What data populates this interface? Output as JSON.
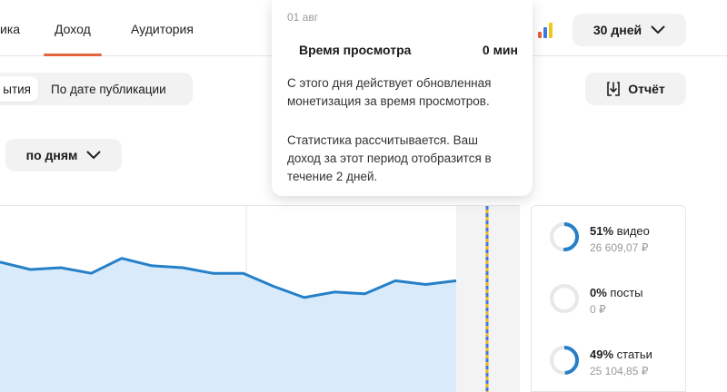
{
  "tabs": [
    {
      "label": "ика"
    },
    {
      "label": "Доход"
    },
    {
      "label": "Аудитория"
    }
  ],
  "period": {
    "label": "30 дней"
  },
  "segment": {
    "items": [
      {
        "label": "ытия"
      },
      {
        "label": "По дате публикации"
      }
    ]
  },
  "report": {
    "label": "Отчёт"
  },
  "granularity": {
    "label": "по дням"
  },
  "tooltip": {
    "date": "01 авг",
    "metric": "Время просмотра",
    "value": "0 мин",
    "text1_line1": "С этого дня действует обновленная",
    "text1_line2": "монетизация за время просмотров.",
    "text2_line1": "Статистика рассчитывается. Ваш",
    "text2_line2": "доход за этот период отобразится в",
    "text2_line3": "течение 2 дней."
  },
  "breakdown": [
    {
      "percent": "51%",
      "label": "видео",
      "amount": "26 609,07 ₽",
      "fraction": 0.51
    },
    {
      "percent": "0%",
      "label": "посты",
      "amount": "0 ₽",
      "fraction": 0
    },
    {
      "percent": "49%",
      "label": "статьи",
      "amount": "25 104,85 ₽",
      "fraction": 0.49
    }
  ],
  "colors": {
    "line": "#2680c8",
    "area": "#d9ebfb",
    "accent": "#e3633b",
    "ring": "#2680c8",
    "ring_track": "#e8e8e8"
  },
  "chart_data": {
    "type": "area",
    "values": [
      70,
      66,
      67,
      64,
      72,
      68,
      67,
      64,
      64,
      57,
      51,
      54,
      53,
      60,
      58,
      60
    ]
  }
}
